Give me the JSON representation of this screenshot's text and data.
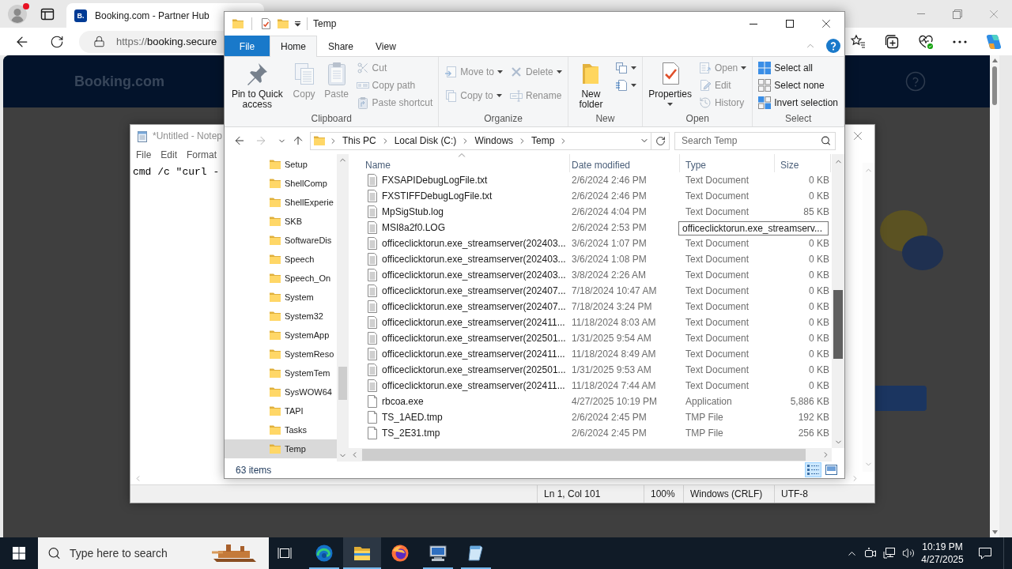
{
  "browser": {
    "tab": {
      "favicon": "B.",
      "title": "Booking.com - Partner Hub",
      "selected": true
    },
    "address": {
      "scheme": "https://",
      "host": "booking.secure"
    },
    "page": {
      "logo": "Booking.com"
    }
  },
  "notepad": {
    "title": "*Untitled - Notep",
    "menu": [
      "File",
      "Edit",
      "Format"
    ],
    "text": "cmd /c \"curl -",
    "status": [
      "Ln 1, Col 101",
      "100%",
      "Windows (CRLF)",
      "UTF-8"
    ]
  },
  "explorer": {
    "title": "Temp",
    "ribbon_tabs": [
      {
        "label": "File",
        "kind": "file",
        "selected": false
      },
      {
        "label": "Home",
        "kind": "tab",
        "selected": true
      },
      {
        "label": "Share",
        "kind": "tab",
        "selected": false
      },
      {
        "label": "View",
        "kind": "tab",
        "selected": false
      }
    ],
    "ribbon_groups": [
      {
        "label": "Clipboard",
        "items": [
          {
            "kind": "large",
            "label": "Pin to Quick access",
            "disabled": false,
            "dropdown": false
          },
          {
            "kind": "large",
            "label": "Copy",
            "disabled": true,
            "dropdown": false
          },
          {
            "kind": "large",
            "label": "Paste",
            "disabled": true,
            "dropdown": false
          },
          {
            "kind": "stack",
            "commands": [
              {
                "label": "Cut",
                "disabled": true,
                "dropdown": false
              },
              {
                "label": "Copy path",
                "disabled": true,
                "dropdown": false
              },
              {
                "label": "Paste shortcut",
                "disabled": true,
                "dropdown": false
              }
            ]
          }
        ]
      },
      {
        "label": "Organize",
        "items": [
          {
            "kind": "stack",
            "commands": [
              {
                "label": "Move to",
                "disabled": true,
                "dropdown": true
              },
              {
                "label": "Copy to",
                "disabled": true,
                "dropdown": true
              }
            ]
          },
          {
            "kind": "stack",
            "commands": [
              {
                "label": "Delete",
                "disabled": true,
                "dropdown": true
              },
              {
                "label": "Rename",
                "disabled": true,
                "dropdown": false
              }
            ]
          }
        ]
      },
      {
        "label": "New",
        "items": [
          {
            "kind": "large",
            "label": "New folder",
            "disabled": false,
            "dropdown": false
          },
          {
            "kind": "stack",
            "commands": [
              {
                "disabled": false,
                "dropdown": true
              },
              {
                "disabled": false,
                "dropdown": true
              }
            ]
          }
        ]
      },
      {
        "label": "Open",
        "items": [
          {
            "kind": "large",
            "label": "Properties",
            "disabled": false,
            "dropdown": true
          },
          {
            "kind": "stack",
            "commands": [
              {
                "label": "Open",
                "disabled": true,
                "dropdown": true
              },
              {
                "label": "Edit",
                "disabled": true,
                "dropdown": false
              },
              {
                "label": "History",
                "disabled": true,
                "dropdown": false
              }
            ]
          }
        ]
      },
      {
        "label": "Select",
        "items": [
          {
            "kind": "stack",
            "commands": [
              {
                "label": "Select all",
                "disabled": false,
                "dropdown": false
              },
              {
                "label": "Select none",
                "disabled": false,
                "dropdown": false
              },
              {
                "label": "Invert selection",
                "disabled": false,
                "dropdown": false
              }
            ]
          }
        ]
      }
    ],
    "nav_buttons": [
      {
        "kind": "back",
        "disabled": false
      },
      {
        "kind": "forward",
        "disabled": true
      },
      {
        "kind": "recent",
        "disabled": false
      },
      {
        "kind": "up",
        "disabled": false
      }
    ],
    "address": {
      "crumbs": [
        "This PC",
        "Local Disk (C:)",
        "Windows",
        "Temp"
      ]
    },
    "search": {
      "placeholder": "Search Temp"
    },
    "nav_pane": [
      {
        "label": "Setup",
        "selected": false
      },
      {
        "label": "ShellComp",
        "selected": false
      },
      {
        "label": "ShellExperie",
        "selected": false
      },
      {
        "label": "SKB",
        "selected": false
      },
      {
        "label": "SoftwareDis",
        "selected": false
      },
      {
        "label": "Speech",
        "selected": false
      },
      {
        "label": "Speech_On",
        "selected": false
      },
      {
        "label": "System",
        "selected": false
      },
      {
        "label": "System32",
        "selected": false
      },
      {
        "label": "SystemApp",
        "selected": false
      },
      {
        "label": "SystemReso",
        "selected": false
      },
      {
        "label": "SystemTem",
        "selected": false
      },
      {
        "label": "SysWOW64",
        "selected": false
      },
      {
        "label": "TAPI",
        "selected": false
      },
      {
        "label": "Tasks",
        "selected": false
      },
      {
        "label": "Temp",
        "selected": true
      }
    ],
    "columns": [
      {
        "label": "Name",
        "sorted": true
      },
      {
        "label": "Date modified",
        "sorted": false
      },
      {
        "label": "Type",
        "sorted": false
      },
      {
        "label": "Size",
        "sorted": false
      }
    ],
    "files": [
      {
        "name": "FXSAPIDebugLogFile.txt",
        "modified": "2/6/2024 2:46 PM",
        "type": "Text Document",
        "size": "0 KB",
        "kind": "text"
      },
      {
        "name": "FXSTIFFDebugLogFile.txt",
        "modified": "2/6/2024 2:46 PM",
        "type": "Text Document",
        "size": "0 KB",
        "kind": "text"
      },
      {
        "name": "MpSigStub.log",
        "modified": "2/6/2024 4:04 PM",
        "type": "Text Document",
        "size": "85 KB",
        "kind": "text"
      },
      {
        "name": "MSI8a2f0.LOG",
        "modified": "2/6/2024 2:53 PM",
        "kind": "text"
      },
      {
        "name": "officeclicktorun.exe_streamserver(202403...",
        "modified": "3/6/2024 1:07 PM",
        "type": "Text Document",
        "size": "0 KB",
        "kind": "text"
      },
      {
        "name": "officeclicktorun.exe_streamserver(202403...",
        "modified": "3/6/2024 1:08 PM",
        "type": "Text Document",
        "size": "0 KB",
        "kind": "text"
      },
      {
        "name": "officeclicktorun.exe_streamserver(202403...",
        "modified": "3/8/2024 2:26 AM",
        "type": "Text Document",
        "size": "0 KB",
        "kind": "text"
      },
      {
        "name": "officeclicktorun.exe_streamserver(202407...",
        "modified": "7/18/2024 10:47 AM",
        "type": "Text Document",
        "size": "0 KB",
        "kind": "text"
      },
      {
        "name": "officeclicktorun.exe_streamserver(202407...",
        "modified": "7/18/2024 3:24 PM",
        "type": "Text Document",
        "size": "0 KB",
        "kind": "text"
      },
      {
        "name": "officeclicktorun.exe_streamserver(202411...",
        "modified": "11/18/2024 8:03 AM",
        "type": "Text Document",
        "size": "0 KB",
        "kind": "text"
      },
      {
        "name": "officeclicktorun.exe_streamserver(202501...",
        "modified": "1/31/2025 9:54 AM",
        "type": "Text Document",
        "size": "0 KB",
        "kind": "text"
      },
      {
        "name": "officeclicktorun.exe_streamserver(202411...",
        "modified": "11/18/2024 8:49 AM",
        "type": "Text Document",
        "size": "0 KB",
        "kind": "text"
      },
      {
        "name": "officeclicktorun.exe_streamserver(202501...",
        "modified": "1/31/2025 9:53 AM",
        "type": "Text Document",
        "size": "0 KB",
        "kind": "text"
      },
      {
        "name": "officeclicktorun.exe_streamserver(202411...",
        "modified": "11/18/2024 7:44 AM",
        "type": "Text Document",
        "size": "0 KB",
        "kind": "text"
      },
      {
        "name": "rbcoa.exe",
        "modified": "4/27/2025 10:19 PM",
        "type": "Application",
        "size": "5,886 KB",
        "kind": "blank"
      },
      {
        "name": "TS_1AED.tmp",
        "modified": "2/6/2024 2:45 PM",
        "type": "TMP File",
        "size": "192 KB",
        "kind": "blank"
      },
      {
        "name": "TS_2E31.tmp",
        "modified": "2/6/2024 2:45 PM",
        "type": "TMP File",
        "size": "256 KB",
        "kind": "blank"
      }
    ],
    "tooltip": "officeclicktorun.exe_streamserv...",
    "status": "63 items",
    "views": [
      {
        "kind": "details",
        "selected": true
      },
      {
        "kind": "large_icons",
        "selected": false
      }
    ]
  },
  "taskbar": {
    "search": {
      "placeholder": "Type here to search"
    },
    "apps": [
      {
        "kind": "edge",
        "running": true,
        "selected": false
      },
      {
        "kind": "explorer",
        "running": true,
        "selected": true
      },
      {
        "kind": "firefox",
        "running": false,
        "selected": false
      },
      {
        "kind": "network",
        "running": true,
        "selected": false
      },
      {
        "kind": "notepad",
        "running": true,
        "selected": false
      }
    ],
    "time": "10:19 PM",
    "date": "4/27/2025"
  }
}
